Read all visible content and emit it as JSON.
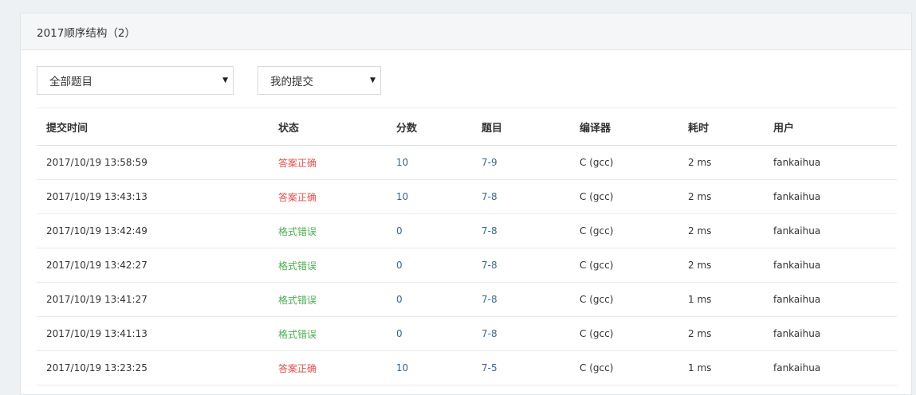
{
  "panel": {
    "title": "2017顺序结构（2）"
  },
  "filters": {
    "problem_select": "全部题目",
    "scope_select": "我的提交",
    "arrow": "▼"
  },
  "table": {
    "headers": {
      "time": "提交时间",
      "status": "状态",
      "score": "分数",
      "problem": "题目",
      "compiler": "编译器",
      "cost": "耗时",
      "user": "用户"
    },
    "rows": [
      {
        "time": "2017/10/19 13:58:59",
        "status": "答案正确",
        "status_type": "ok",
        "score": "10",
        "problem": "7-9",
        "compiler": "C (gcc)",
        "cost": "2 ms",
        "user": "fankaihua"
      },
      {
        "time": "2017/10/19 13:43:13",
        "status": "答案正确",
        "status_type": "ok",
        "score": "10",
        "problem": "7-8",
        "compiler": "C (gcc)",
        "cost": "2 ms",
        "user": "fankaihua"
      },
      {
        "time": "2017/10/19 13:42:49",
        "status": "格式错误",
        "status_type": "fmt",
        "score": "0",
        "problem": "7-8",
        "compiler": "C (gcc)",
        "cost": "2 ms",
        "user": "fankaihua"
      },
      {
        "time": "2017/10/19 13:42:27",
        "status": "格式错误",
        "status_type": "fmt",
        "score": "0",
        "problem": "7-8",
        "compiler": "C (gcc)",
        "cost": "2 ms",
        "user": "fankaihua"
      },
      {
        "time": "2017/10/19 13:41:27",
        "status": "格式错误",
        "status_type": "fmt",
        "score": "0",
        "problem": "7-8",
        "compiler": "C (gcc)",
        "cost": "1 ms",
        "user": "fankaihua"
      },
      {
        "time": "2017/10/19 13:41:13",
        "status": "格式错误",
        "status_type": "fmt",
        "score": "0",
        "problem": "7-8",
        "compiler": "C (gcc)",
        "cost": "2 ms",
        "user": "fankaihua"
      },
      {
        "time": "2017/10/19 13:23:25",
        "status": "答案正确",
        "status_type": "ok",
        "score": "10",
        "problem": "7-5",
        "compiler": "C (gcc)",
        "cost": "1 ms",
        "user": "fankaihua"
      }
    ]
  },
  "colors": {
    "status_ok": "#e0504d",
    "status_format_error": "#4caf50",
    "link": "#336699"
  }
}
